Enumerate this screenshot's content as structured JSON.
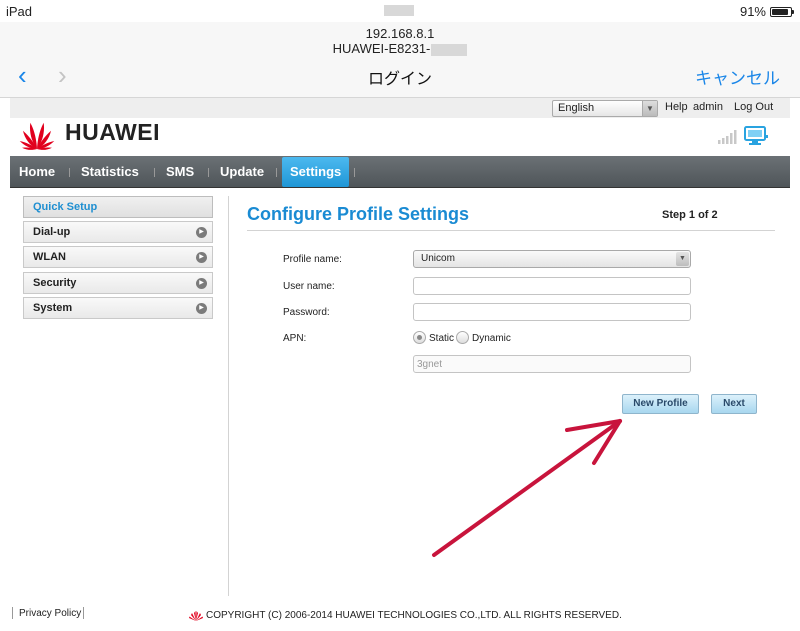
{
  "ios": {
    "device": "iPad",
    "battery_percent": "91%",
    "battery_level": 0.91,
    "url_host": "192.168.8.1",
    "page_device_name": "HUAWEI-E8231-",
    "nav_title": "ログイン",
    "cancel_label": "キャンセル",
    "back_glyph": "‹",
    "forward_glyph": "›"
  },
  "topbar": {
    "language": "English",
    "help": "Help",
    "user": "admin",
    "logout": "Log Out"
  },
  "brand": {
    "name": "HUAWEI"
  },
  "menu": {
    "items": [
      "Home",
      "Statistics",
      "SMS",
      "Update",
      "Settings"
    ],
    "active": "Settings"
  },
  "sidebar": {
    "items": [
      "Quick Setup",
      "Dial-up",
      "WLAN",
      "Security",
      "System"
    ]
  },
  "content": {
    "heading": "Configure Profile Settings",
    "step": "Step 1 of 2",
    "fields": {
      "profile_name_label": "Profile name:",
      "profile_name_value": "Unicom",
      "username_label": "User name:",
      "username_value": "",
      "password_label": "Password:",
      "password_value": "",
      "apn_label": "APN:",
      "apn_static": "Static",
      "apn_dynamic": "Dynamic",
      "apn_value": "3gnet"
    },
    "buttons": {
      "new_profile": "New Profile",
      "next": "Next"
    }
  },
  "footer": {
    "privacy": "Privacy Policy",
    "copyright": "COPYRIGHT (C) 2006-2014 HUAWEI TECHNOLOGIES CO.,LTD. ALL RIGHTS RESERVED."
  },
  "colors": {
    "accent_blue": "#1a8bd3",
    "ios_blue": "#1a86e8",
    "annotation_arrow": "#c8143c",
    "huawei_red": "#e1001e"
  },
  "icons": {
    "signal": "signal-strength-icon",
    "connection": "monitor-connection-icon",
    "sidebar_arrow": "circle-arrow-right-icon"
  }
}
